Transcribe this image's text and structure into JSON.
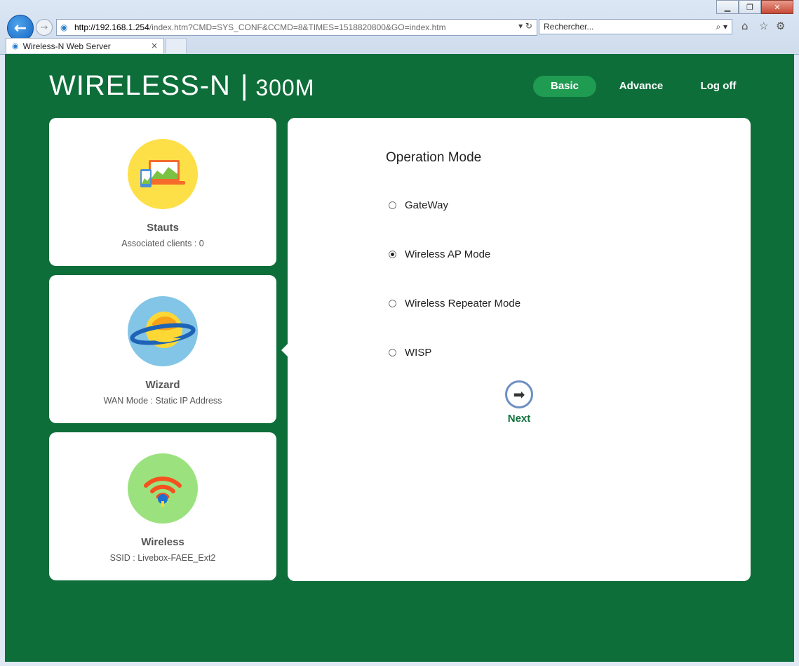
{
  "browser": {
    "url_host": "http://192.168.1.254",
    "url_rest": "/index.htm?CMD=SYS_CONF&CCMD=8&TIMES=1518820800&GO=index.htm",
    "search_placeholder": "Rechercher...",
    "tab_title": "Wireless-N Web Server",
    "tab_close": "×"
  },
  "brand": {
    "title": "WIRELESS-N",
    "separator": "|",
    "subtitle": "300M"
  },
  "nav": {
    "basic": "Basic",
    "advance": "Advance",
    "logoff": "Log off"
  },
  "cards": [
    {
      "title": "Stauts",
      "sub": "Associated clients : 0",
      "color": "#fde047"
    },
    {
      "title": "Wizard",
      "sub": "WAN Mode : Static IP Address",
      "color": "#83c5e7"
    },
    {
      "title": "Wireless",
      "sub": "SSID : Livebox-FAEE_Ext2",
      "color": "#9be27f"
    }
  ],
  "main": {
    "heading": "Operation Mode",
    "options": [
      {
        "label": "GateWay",
        "selected": false
      },
      {
        "label": "Wireless AP Mode",
        "selected": true
      },
      {
        "label": "Wireless Repeater Mode",
        "selected": false
      },
      {
        "label": "WISP",
        "selected": false
      }
    ],
    "next_label": "Next"
  },
  "colors": {
    "page_bg": "#0e6e3a",
    "active_nav": "#1f9b52"
  }
}
